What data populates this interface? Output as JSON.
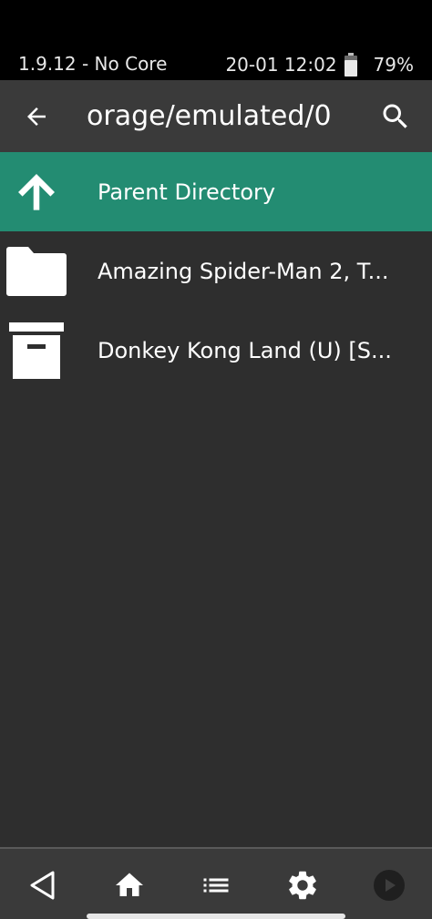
{
  "status_bar": {
    "left_text": "1.9.12 - No Core",
    "datetime": "20-01 12:02",
    "battery_percent": "79%",
    "battery_level": 0.79
  },
  "header": {
    "title": "orage/emulated/0",
    "back_icon": "arrow-left-icon",
    "search_icon": "search-icon"
  },
  "list": {
    "items": [
      {
        "label": "Parent Directory",
        "icon": "arrow-up-icon",
        "selected": true
      },
      {
        "label": "Amazing Spider-Man 2, T...",
        "icon": "folder-icon",
        "selected": false
      },
      {
        "label": "Donkey Kong Land (U) [S...",
        "icon": "archive-icon",
        "selected": false
      }
    ]
  },
  "bottom_nav": {
    "items": [
      {
        "icon": "back-triangle-icon"
      },
      {
        "icon": "home-icon"
      },
      {
        "icon": "list-icon"
      },
      {
        "icon": "gear-icon"
      },
      {
        "icon": "play-circle-icon"
      }
    ]
  },
  "colors": {
    "background": "#2e2e2e",
    "header": "#3a3a3a",
    "selected": "#238c72",
    "status_bar": "#000000"
  }
}
